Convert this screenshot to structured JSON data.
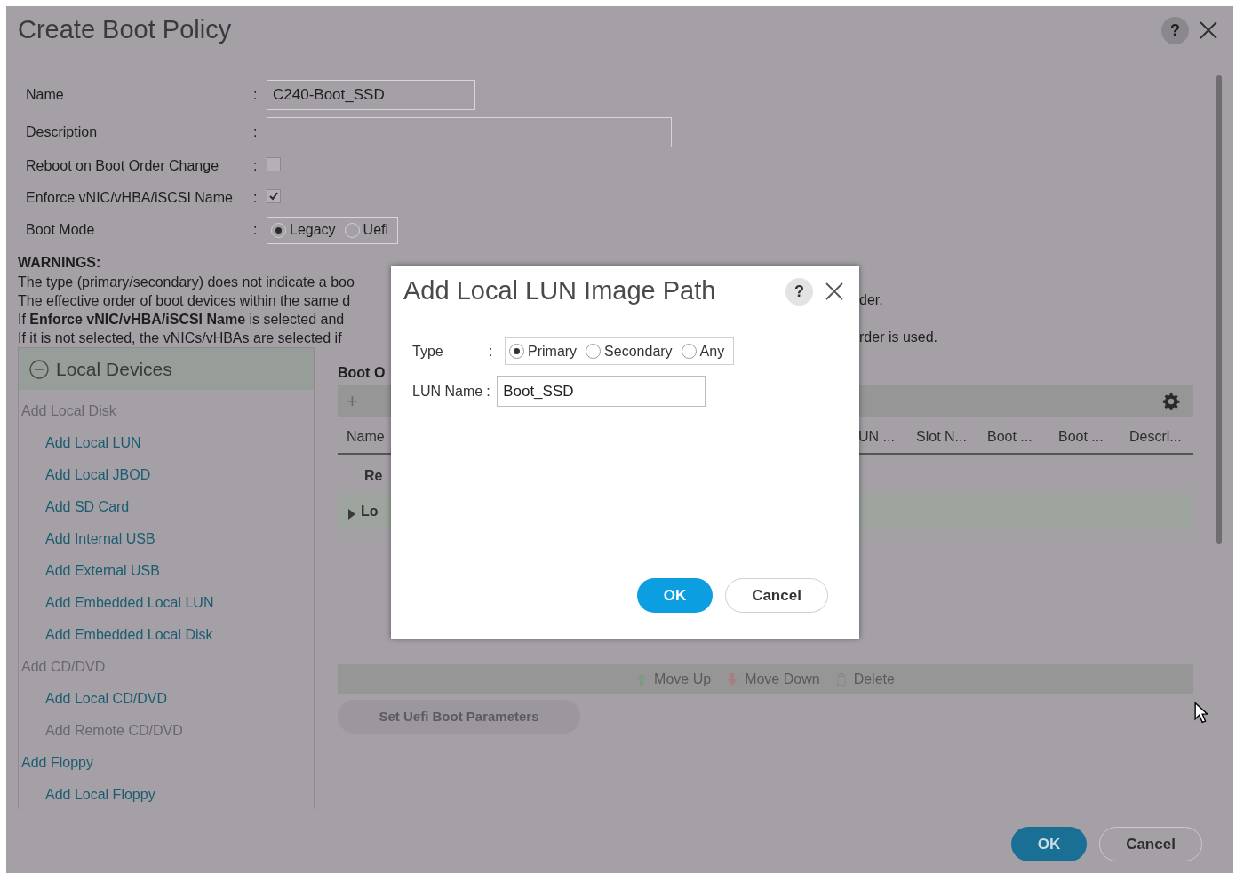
{
  "dialog": {
    "title": "Create Boot Policy",
    "help": "?"
  },
  "form": [
    {
      "kind": "text",
      "label": "Name",
      "separator": ":",
      "value": "C240-Boot_SSD"
    },
    {
      "kind": "text",
      "label": "Description",
      "separator": ":"
    },
    {
      "kind": "checkbox",
      "label": "Reboot on Boot Order Change",
      "separator": ":",
      "checked": false
    },
    {
      "kind": "checkbox",
      "label": "Enforce vNIC/vHBA/iSCSI Name",
      "separator": ":",
      "checked": true
    },
    {
      "kind": "radio",
      "label": "Boot Mode",
      "separator": ":",
      "options": [
        {
          "label": "Legacy",
          "selected": true
        },
        {
          "label": "Uefi",
          "selected": false
        }
      ]
    }
  ],
  "warnings": {
    "title": "WARNINGS:",
    "lines": [
      {
        "left": "The type (primary/secondary) does not indicate a boo"
      },
      {
        "left": "The effective order of boot devices within the same d",
        "right": "der."
      },
      {
        "left": "If **Enforce vNIC/vHBA/iSCSI Name** is selected and"
      },
      {
        "left": "If it is not selected, the vNICs/vHBAs are selected if",
        "right": "rder is used."
      }
    ]
  },
  "local_devices": {
    "title": "Local Devices",
    "expanded": true,
    "items": [
      {
        "label": "Add Local Disk",
        "disabled": true,
        "children": [
          {
            "label": "Add Local LUN",
            "disabled": false
          },
          {
            "label": "Add Local JBOD",
            "disabled": false
          },
          {
            "label": "Add SD Card",
            "disabled": false
          },
          {
            "label": "Add Internal USB",
            "disabled": false
          },
          {
            "label": "Add External USB",
            "disabled": false
          },
          {
            "label": "Add Embedded Local LUN",
            "disabled": false
          },
          {
            "label": "Add Embedded Local Disk",
            "disabled": false
          }
        ]
      },
      {
        "label": "Add CD/DVD",
        "disabled": true,
        "children": [
          {
            "label": "Add Local CD/DVD",
            "disabled": false
          },
          {
            "label": "Add Remote CD/DVD",
            "disabled": true
          }
        ]
      },
      {
        "label": "Add Floppy",
        "disabled": false,
        "children": [
          {
            "label": "Add Local Floppy",
            "disabled": false
          }
        ]
      }
    ]
  },
  "boot_order": {
    "title": "Boot O",
    "add": "+",
    "columns_left": [
      "Name"
    ],
    "columns_right": [
      "UN ...",
      "Slot N...",
      "Boot ...",
      "Boot ...",
      "Descri..."
    ],
    "rows": [
      {
        "label": "Re",
        "expandable": false
      },
      {
        "label": "Lo",
        "expandable": true
      }
    ],
    "actions": [
      {
        "kind": "up",
        "label": "Move Up",
        "disabled": true
      },
      {
        "kind": "down",
        "label": "Move Down",
        "disabled": true
      },
      {
        "kind": "delete",
        "label": "Delete",
        "disabled": true
      }
    ],
    "uefi_button": {
      "label": "Set Uefi Boot Parameters",
      "disabled": true
    }
  },
  "buttons": [
    {
      "label": "OK",
      "primary": true
    },
    {
      "label": "Cancel",
      "primary": false
    }
  ],
  "modal": {
    "title": "Add Local LUN Image Path",
    "help": "?",
    "fields": [
      {
        "kind": "radio",
        "label": "Type",
        "separator": ":",
        "options": [
          {
            "label": "Primary",
            "selected": true
          },
          {
            "label": "Secondary",
            "selected": false
          },
          {
            "label": "Any",
            "selected": false
          }
        ]
      },
      {
        "kind": "text",
        "label": "LUN Name",
        "separator": ":",
        "value": "Boot_SSD"
      }
    ],
    "buttons": [
      {
        "label": "OK",
        "primary": true
      },
      {
        "label": "Cancel",
        "primary": false
      }
    ]
  }
}
